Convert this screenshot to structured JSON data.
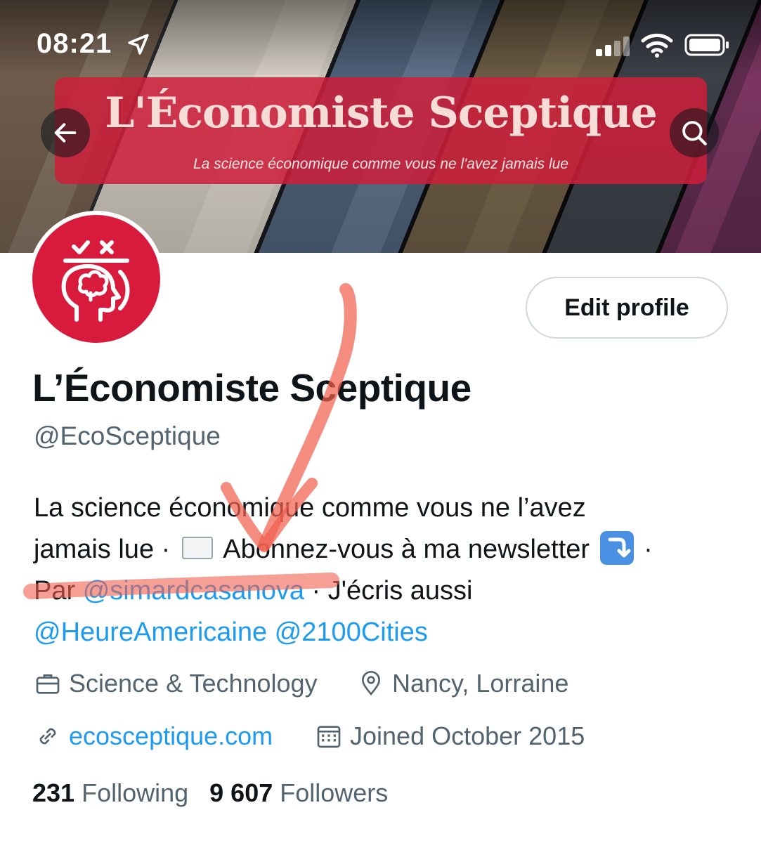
{
  "status_bar": {
    "time": "08:21",
    "location_icon": "location-arrow-icon",
    "signal_icon": "cellular-signal-icon",
    "wifi_icon": "wifi-icon",
    "battery_icon": "battery-icon"
  },
  "banner": {
    "title": "L'Économiste Sceptique",
    "subtitle": "La science économique comme vous ne l'avez jamais lue",
    "plate_color": "#cd1e3a"
  },
  "nav": {
    "back_icon": "arrow-left-icon",
    "search_icon": "search-icon"
  },
  "profile": {
    "avatar_icon": "head-brain-icon",
    "avatar_color": "#d81b3c",
    "edit_button_label": "Edit profile",
    "display_name": "L’Économiste Sceptique",
    "handle": "@EcoSceptique",
    "bio": {
      "line1": "La science économique comme vous ne l’avez",
      "line2_a": "jamais lue · ",
      "line2_b": " Abonnez-vous à ma newsletter ",
      "line2_c": " ·",
      "line3_a": "Par ",
      "line3_mention": "@simardcasanova",
      "line3_b": " · J'écris aussi",
      "line4_mention1": "@HeureAmericaine",
      "line4_sep": " ",
      "line4_mention2": "@2100Cities",
      "emoji1": "envelope-icon",
      "emoji2": "arrow-down-right-icon"
    },
    "category": "Science & Technology",
    "location": "Nancy, Lorraine",
    "website": "ecosceptique.com",
    "joined": "Joined October 2015",
    "following_count": "231",
    "following_label": "Following",
    "followers_count": "9 607",
    "followers_label": "Followers"
  },
  "colors": {
    "link": "#1d9bf0",
    "secondary_text": "#536471",
    "annotation": "#f0604f"
  }
}
